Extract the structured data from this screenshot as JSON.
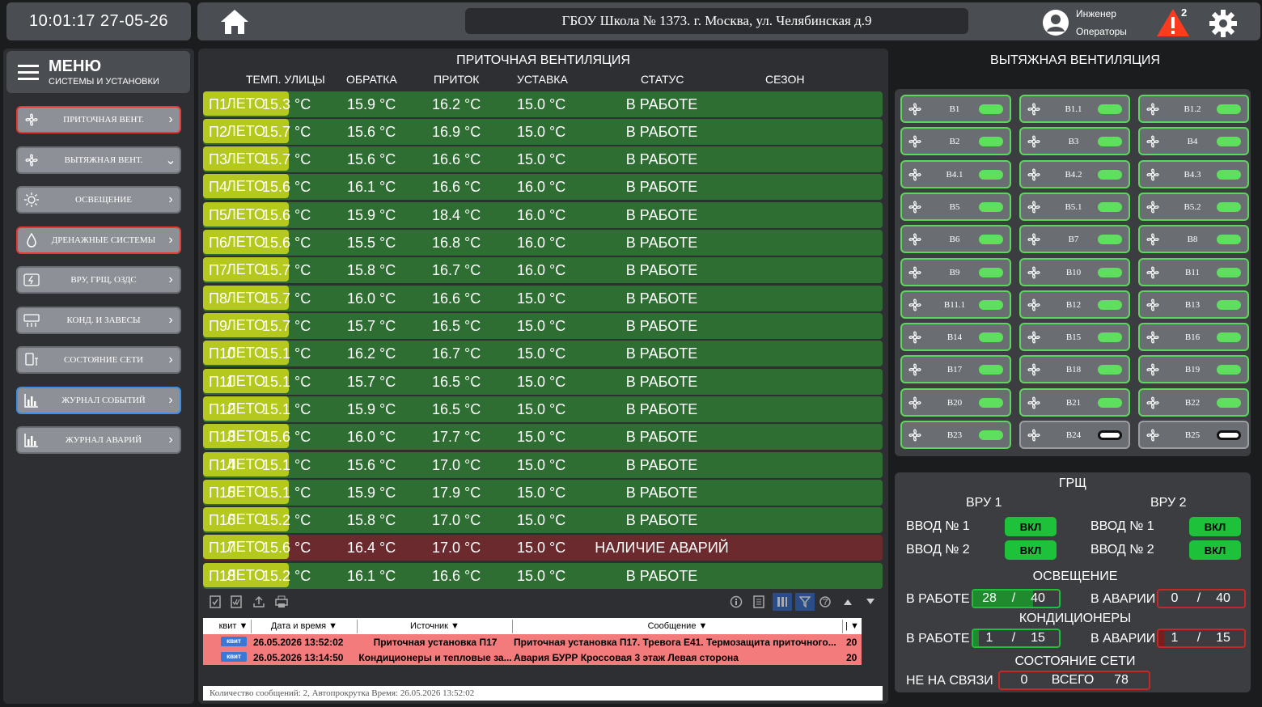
{
  "clock": "10:01:17 27-05-26",
  "title": "ГБОУ Школа № 1373. г. Москва, ул. Челябинская д.9",
  "user": {
    "role": "Инженер",
    "group": "Операторы"
  },
  "alarm_count": "2",
  "menu": {
    "title": "МЕНЮ",
    "subtitle": "СИСТЕМЫ И УСТАНОВКИ",
    "items": [
      {
        "label": "ПРИТОЧНАЯ ВЕНТ.",
        "icon": "fan-icon",
        "chevron": "›"
      },
      {
        "label": "ВЫТЯЖНАЯ ВЕНТ.",
        "icon": "fan-icon",
        "chevron": "⌄"
      },
      {
        "label": "ОСВЕЩЕНИЕ",
        "icon": "sun-icon",
        "chevron": "›"
      },
      {
        "label": "ДРЕНАЖНЫЕ СИСТЕМЫ",
        "icon": "drop-icon",
        "chevron": "›"
      },
      {
        "label": "ВРУ, ГРЩ, ОЗДС",
        "icon": "power-icon",
        "chevron": "›"
      },
      {
        "label": "КОНД. И ЗАВЕСЫ",
        "icon": "ac-icon",
        "chevron": "›"
      },
      {
        "label": "СОСТОЯНИЕ СЕТИ",
        "icon": "network-icon",
        "chevron": "›"
      },
      {
        "label": "ЖУРНАЛ СОБЫТИЙ",
        "icon": "chart-icon",
        "chevron": "›"
      },
      {
        "label": "ЖУРНАЛ АВАРИЙ",
        "icon": "chart-icon",
        "chevron": "›"
      }
    ]
  },
  "supply": {
    "title": "ПРИТОЧНАЯ ВЕНТИЛЯЦИЯ",
    "headers": [
      "ТЕМП. УЛИЦЫ",
      "ОБРАТКА",
      "ПРИТОК",
      "УСТАВКА",
      "СТАТУС",
      "СЕЗОН"
    ],
    "rows": [
      {
        "name": "П1",
        "street": "15.3 °C",
        "ret": "15.9 °C",
        "supply": "16.2 °C",
        "set": "15.0 °C",
        "status": "В РАБОТЕ",
        "season": "ЛЕТО"
      },
      {
        "name": "П2",
        "street": "15.7 °C",
        "ret": "15.6 °C",
        "supply": "16.9 °C",
        "set": "15.0 °C",
        "status": "В РАБОТЕ",
        "season": "ЛЕТО"
      },
      {
        "name": "П3",
        "street": "15.7 °C",
        "ret": "15.6 °C",
        "supply": "16.6 °C",
        "set": "15.0 °C",
        "status": "В РАБОТЕ",
        "season": "ЛЕТО"
      },
      {
        "name": "П4",
        "street": "15.6 °C",
        "ret": "16.1 °C",
        "supply": "16.6 °C",
        "set": "16.0 °C",
        "status": "В РАБОТЕ",
        "season": "ЛЕТО"
      },
      {
        "name": "П5",
        "street": "15.6 °C",
        "ret": "15.9 °C",
        "supply": "18.4 °C",
        "set": "16.0 °C",
        "status": "В РАБОТЕ",
        "season": "ЛЕТО"
      },
      {
        "name": "П6",
        "street": "15.6 °C",
        "ret": "15.5 °C",
        "supply": "16.8 °C",
        "set": "16.0 °C",
        "status": "В РАБОТЕ",
        "season": "ЛЕТО"
      },
      {
        "name": "П7",
        "street": "15.7 °C",
        "ret": "15.8 °C",
        "supply": "16.7 °C",
        "set": "16.0 °C",
        "status": "В РАБОТЕ",
        "season": "ЛЕТО"
      },
      {
        "name": "П8",
        "street": "15.7 °C",
        "ret": "16.0 °C",
        "supply": "16.6 °C",
        "set": "15.0 °C",
        "status": "В РАБОТЕ",
        "season": "ЛЕТО"
      },
      {
        "name": "П9",
        "street": "15.7 °C",
        "ret": "15.7 °C",
        "supply": "16.5 °C",
        "set": "15.0 °C",
        "status": "В РАБОТЕ",
        "season": "ЛЕТО"
      },
      {
        "name": "П10",
        "street": "15.1 °C",
        "ret": "16.2 °C",
        "supply": "16.7 °C",
        "set": "15.0 °C",
        "status": "В РАБОТЕ",
        "season": "ЛЕТО"
      },
      {
        "name": "П11",
        "street": "15.1 °C",
        "ret": "15.7 °C",
        "supply": "16.5 °C",
        "set": "15.0 °C",
        "status": "В РАБОТЕ",
        "season": "ЛЕТО"
      },
      {
        "name": "П12",
        "street": "15.1 °C",
        "ret": "15.9 °C",
        "supply": "16.5 °C",
        "set": "15.0 °C",
        "status": "В РАБОТЕ",
        "season": "ЛЕТО"
      },
      {
        "name": "П13",
        "street": "15.6 °C",
        "ret": "16.0 °C",
        "supply": "17.7 °C",
        "set": "15.0 °C",
        "status": "В РАБОТЕ",
        "season": "ЛЕТО"
      },
      {
        "name": "П14",
        "street": "15.1 °C",
        "ret": "15.6 °C",
        "supply": "17.0 °C",
        "set": "15.0 °C",
        "status": "В РАБОТЕ",
        "season": "ЛЕТО"
      },
      {
        "name": "П15",
        "street": "15.1 °C",
        "ret": "15.9 °C",
        "supply": "17.9 °C",
        "set": "15.0 °C",
        "status": "В РАБОТЕ",
        "season": "ЛЕТО"
      },
      {
        "name": "П16",
        "street": "15.2 °C",
        "ret": "15.8 °C",
        "supply": "17.0 °C",
        "set": "15.0 °C",
        "status": "В РАБОТЕ",
        "season": "ЛЕТО"
      },
      {
        "name": "П17",
        "street": "15.6 °C",
        "ret": "16.4 °C",
        "supply": "17.0 °C",
        "set": "15.0 °C",
        "status": "НАЛИЧИЕ АВАРИЙ",
        "season": "ЛЕТО",
        "alarm": true
      },
      {
        "name": "П18",
        "street": "15.2 °C",
        "ret": "16.1 °C",
        "supply": "16.6 °C",
        "set": "15.0 °C",
        "status": "В РАБОТЕ",
        "season": "ЛЕТО"
      }
    ]
  },
  "events": {
    "columns": [
      "квит",
      "Дата и время",
      "Источник",
      "Сообщение",
      ""
    ],
    "rows": [
      {
        "ack": "квит",
        "time": "26.05.2026 13:52:02",
        "source": "Приточная установка П17",
        "message": "Приточная установка П17. Тревога E41. Термозащита приточного...",
        "prio": "20"
      },
      {
        "ack": "квит",
        "time": "26.05.2026 13:14:50",
        "source": "Кондиционеры и тепловые за...",
        "message": "Авария БУРР Кроссовая 3 этаж Левая сторона",
        "prio": "20"
      }
    ],
    "status": "Количество сообщений: 2, Автопрокрутка Время: 26.05.2026 13:52:02"
  },
  "exhaust": {
    "title": "ВЫТЯЖНАЯ ВЕНТИЛЯЦИЯ",
    "fans": [
      {
        "name": "В1",
        "on": true
      },
      {
        "name": "В1.1",
        "on": true
      },
      {
        "name": "В1.2",
        "on": true
      },
      {
        "name": "В2",
        "on": true
      },
      {
        "name": "В3",
        "on": true
      },
      {
        "name": "В4",
        "on": true
      },
      {
        "name": "В4.1",
        "on": true
      },
      {
        "name": "В4.2",
        "on": true
      },
      {
        "name": "В4.3",
        "on": true
      },
      {
        "name": "В5",
        "on": true
      },
      {
        "name": "В5.1",
        "on": true
      },
      {
        "name": "В5.2",
        "on": true
      },
      {
        "name": "В6",
        "on": true
      },
      {
        "name": "В7",
        "on": true
      },
      {
        "name": "В8",
        "on": true
      },
      {
        "name": "В9",
        "on": true
      },
      {
        "name": "В10",
        "on": true
      },
      {
        "name": "В11",
        "on": true
      },
      {
        "name": "В11.1",
        "on": true
      },
      {
        "name": "В12",
        "on": true
      },
      {
        "name": "В13",
        "on": true
      },
      {
        "name": "В14",
        "on": true
      },
      {
        "name": "В15",
        "on": true
      },
      {
        "name": "В16",
        "on": true
      },
      {
        "name": "В17",
        "on": true
      },
      {
        "name": "В18",
        "on": true
      },
      {
        "name": "В19",
        "on": true
      },
      {
        "name": "В20",
        "on": true
      },
      {
        "name": "В21",
        "on": true
      },
      {
        "name": "В22",
        "on": true
      },
      {
        "name": "В23",
        "on": true
      },
      {
        "name": "В24",
        "on": false
      },
      {
        "name": "В25",
        "on": false
      }
    ]
  },
  "grsh": {
    "title": "ГРЩ",
    "vru1": "ВРУ 1",
    "vru2": "ВРУ 2",
    "input1": "ВВОД № 1",
    "input2": "ВВОД № 2",
    "on_label": "ВКЛ",
    "lighting_title": "ОСВЕЩЕНИЕ",
    "working": "В РАБОТЕ",
    "alarm": "В АВАРИИ",
    "light_work": "28",
    "light_total": "40",
    "light_alarm": "0",
    "light_alarm_total": "40",
    "ac_title": "КОНДИЦИОНЕРЫ",
    "ac_work": "1",
    "ac_total": "15",
    "ac_alarm": "1",
    "ac_alarm_total": "15",
    "net_title": "СОСТОЯНИЕ СЕТИ",
    "offline": "НЕ НА СВЯЗИ",
    "offline_val": "0",
    "total": "ВСЕГО",
    "total_val": "78",
    "slash": "/"
  },
  "colors": {
    "ok_row": "#2f6e32",
    "alarm_row": "#6b2a2e",
    "season": "#b5c81e",
    "fan_on": "#5ee05e",
    "event_row": "#f47b7b"
  }
}
